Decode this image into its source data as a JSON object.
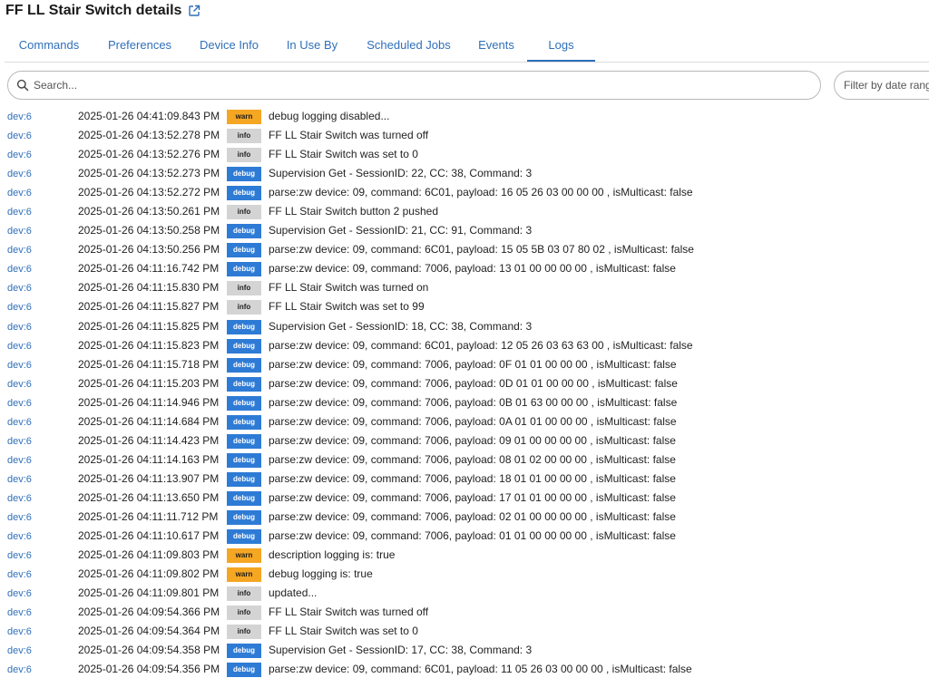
{
  "header": {
    "title": "FF LL Stair Switch details",
    "open_icon": "external-link-icon"
  },
  "tabs": [
    {
      "label": "Commands",
      "active": false
    },
    {
      "label": "Preferences",
      "active": false
    },
    {
      "label": "Device Info",
      "active": false
    },
    {
      "label": "In Use By",
      "active": false
    },
    {
      "label": "Scheduled Jobs",
      "active": false
    },
    {
      "label": "Events",
      "active": false
    },
    {
      "label": "Logs",
      "active": true
    }
  ],
  "search": {
    "placeholder": "Search...",
    "icon": "search-icon"
  },
  "date_filter": {
    "placeholder": "Filter by date rang"
  },
  "colors": {
    "accent": "#2f6fba",
    "warn": "#f5a623",
    "info": "#d4d4d4",
    "debug": "#2e7bd6"
  },
  "logs": [
    {
      "device": "dev:6",
      "time": "2025-01-26 04:41:09.843 PM",
      "level": "warn",
      "message": "debug logging disabled..."
    },
    {
      "device": "dev:6",
      "time": "2025-01-26 04:13:52.278 PM",
      "level": "info",
      "message": "FF LL Stair Switch was turned off"
    },
    {
      "device": "dev:6",
      "time": "2025-01-26 04:13:52.276 PM",
      "level": "info",
      "message": "FF LL Stair Switch was set to 0"
    },
    {
      "device": "dev:6",
      "time": "2025-01-26 04:13:52.273 PM",
      "level": "debug",
      "message": "Supervision Get - SessionID: 22, CC: 38, Command: 3"
    },
    {
      "device": "dev:6",
      "time": "2025-01-26 04:13:52.272 PM",
      "level": "debug",
      "message": "parse:zw device: 09, command: 6C01, payload: 16 05 26 03 00 00 00 , isMulticast: false"
    },
    {
      "device": "dev:6",
      "time": "2025-01-26 04:13:50.261 PM",
      "level": "info",
      "message": "FF LL Stair Switch button 2 pushed"
    },
    {
      "device": "dev:6",
      "time": "2025-01-26 04:13:50.258 PM",
      "level": "debug",
      "message": "Supervision Get - SessionID: 21, CC: 91, Command: 3"
    },
    {
      "device": "dev:6",
      "time": "2025-01-26 04:13:50.256 PM",
      "level": "debug",
      "message": "parse:zw device: 09, command: 6C01, payload: 15 05 5B 03 07 80 02 , isMulticast: false"
    },
    {
      "device": "dev:6",
      "time": "2025-01-26 04:11:16.742 PM",
      "level": "debug",
      "message": "parse:zw device: 09, command: 7006, payload: 13 01 00 00 00 00 , isMulticast: false"
    },
    {
      "device": "dev:6",
      "time": "2025-01-26 04:11:15.830 PM",
      "level": "info",
      "message": "FF LL Stair Switch was turned on"
    },
    {
      "device": "dev:6",
      "time": "2025-01-26 04:11:15.827 PM",
      "level": "info",
      "message": "FF LL Stair Switch was set to 99"
    },
    {
      "device": "dev:6",
      "time": "2025-01-26 04:11:15.825 PM",
      "level": "debug",
      "message": "Supervision Get - SessionID: 18, CC: 38, Command: 3"
    },
    {
      "device": "dev:6",
      "time": "2025-01-26 04:11:15.823 PM",
      "level": "debug",
      "message": "parse:zw device: 09, command: 6C01, payload: 12 05 26 03 63 63 00 , isMulticast: false"
    },
    {
      "device": "dev:6",
      "time": "2025-01-26 04:11:15.718 PM",
      "level": "debug",
      "message": "parse:zw device: 09, command: 7006, payload: 0F 01 01 00 00 00 , isMulticast: false"
    },
    {
      "device": "dev:6",
      "time": "2025-01-26 04:11:15.203 PM",
      "level": "debug",
      "message": "parse:zw device: 09, command: 7006, payload: 0D 01 01 00 00 00 , isMulticast: false"
    },
    {
      "device": "dev:6",
      "time": "2025-01-26 04:11:14.946 PM",
      "level": "debug",
      "message": "parse:zw device: 09, command: 7006, payload: 0B 01 63 00 00 00 , isMulticast: false"
    },
    {
      "device": "dev:6",
      "time": "2025-01-26 04:11:14.684 PM",
      "level": "debug",
      "message": "parse:zw device: 09, command: 7006, payload: 0A 01 01 00 00 00 , isMulticast: false"
    },
    {
      "device": "dev:6",
      "time": "2025-01-26 04:11:14.423 PM",
      "level": "debug",
      "message": "parse:zw device: 09, command: 7006, payload: 09 01 00 00 00 00 , isMulticast: false"
    },
    {
      "device": "dev:6",
      "time": "2025-01-26 04:11:14.163 PM",
      "level": "debug",
      "message": "parse:zw device: 09, command: 7006, payload: 08 01 02 00 00 00 , isMulticast: false"
    },
    {
      "device": "dev:6",
      "time": "2025-01-26 04:11:13.907 PM",
      "level": "debug",
      "message": "parse:zw device: 09, command: 7006, payload: 18 01 01 00 00 00 , isMulticast: false"
    },
    {
      "device": "dev:6",
      "time": "2025-01-26 04:11:13.650 PM",
      "level": "debug",
      "message": "parse:zw device: 09, command: 7006, payload: 17 01 01 00 00 00 , isMulticast: false"
    },
    {
      "device": "dev:6",
      "time": "2025-01-26 04:11:11.712 PM",
      "level": "debug",
      "message": "parse:zw device: 09, command: 7006, payload: 02 01 00 00 00 00 , isMulticast: false"
    },
    {
      "device": "dev:6",
      "time": "2025-01-26 04:11:10.617 PM",
      "level": "debug",
      "message": "parse:zw device: 09, command: 7006, payload: 01 01 00 00 00 00 , isMulticast: false"
    },
    {
      "device": "dev:6",
      "time": "2025-01-26 04:11:09.803 PM",
      "level": "warn",
      "message": "description logging is: true"
    },
    {
      "device": "dev:6",
      "time": "2025-01-26 04:11:09.802 PM",
      "level": "warn",
      "message": "debug logging is: true"
    },
    {
      "device": "dev:6",
      "time": "2025-01-26 04:11:09.801 PM",
      "level": "info",
      "message": "updated..."
    },
    {
      "device": "dev:6",
      "time": "2025-01-26 04:09:54.366 PM",
      "level": "info",
      "message": "FF LL Stair Switch was turned off"
    },
    {
      "device": "dev:6",
      "time": "2025-01-26 04:09:54.364 PM",
      "level": "info",
      "message": "FF LL Stair Switch was set to 0"
    },
    {
      "device": "dev:6",
      "time": "2025-01-26 04:09:54.358 PM",
      "level": "debug",
      "message": "Supervision Get - SessionID: 17, CC: 38, Command: 3"
    },
    {
      "device": "dev:6",
      "time": "2025-01-26 04:09:54.356 PM",
      "level": "debug",
      "message": "parse:zw device: 09, command: 6C01, payload: 11 05 26 03 00 00 00 , isMulticast: false"
    }
  ]
}
